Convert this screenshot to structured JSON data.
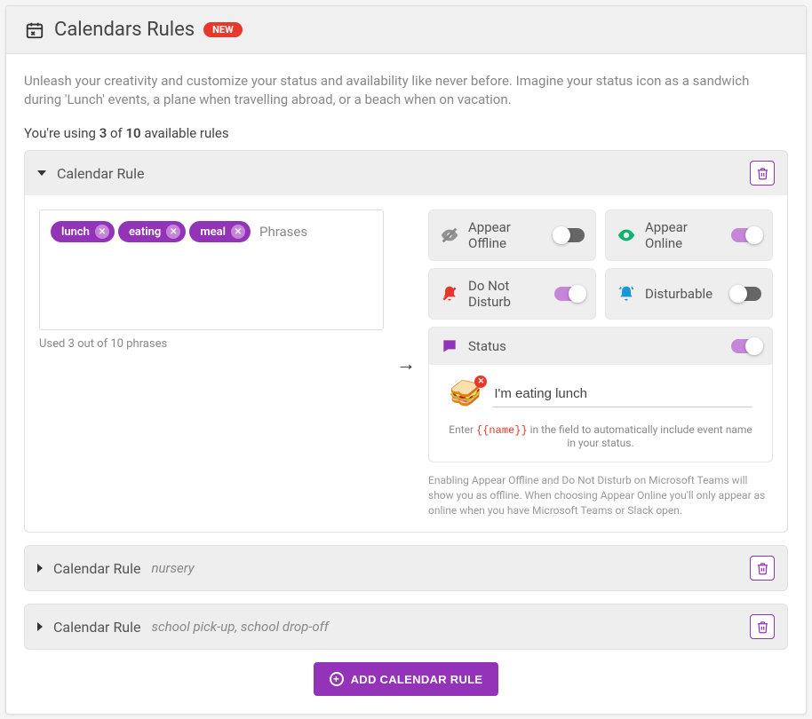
{
  "header": {
    "title": "Calendars Rules",
    "badge": "NEW"
  },
  "intro": "Unleash your creativity and customize your status and availability like never before. Imagine your status icon as a sandwich during 'Lunch' events, a plane when travelling abroad, or a beach when on vacation.",
  "usage": {
    "prefix": "You're using ",
    "used": "3",
    "of": " of ",
    "total": "10",
    "suffix": " available rules"
  },
  "rules": [
    {
      "title": "Calendar Rule",
      "expanded": true,
      "phrases": [
        "lunch",
        "eating",
        "meal"
      ],
      "phrases_placeholder": "Phrases",
      "phrases_usage": "Used 3 out of 10 phrases",
      "toggles": {
        "appear_offline": {
          "label": "Appear Offline",
          "on": false,
          "icon": "eye-off",
          "color": "#888"
        },
        "appear_online": {
          "label": "Appear Online",
          "on": true,
          "icon": "eye",
          "color": "#0bb36d"
        },
        "dnd": {
          "label": "Do Not Disturb",
          "on": true,
          "icon": "bell-off",
          "color": "#e6382c"
        },
        "disturbable": {
          "label": "Disturbable",
          "on": false,
          "icon": "bell",
          "color": "#1997d6"
        }
      },
      "status": {
        "label": "Status",
        "on": true,
        "emoji": "🥪",
        "value": "I'm eating lunch",
        "hint_prefix": "Enter ",
        "hint_code": "{{name}}",
        "hint_suffix": " in the field to automatically include event name in your status."
      },
      "footnote": "Enabling Appear Offline and Do Not Disturb on Microsoft Teams will show you as offline. When choosing Appear Online you'll only appear as online when you have Microsoft Teams or Slack open."
    },
    {
      "title": "Calendar Rule",
      "subtitle": "nursery",
      "expanded": false
    },
    {
      "title": "Calendar Rule",
      "subtitle": "school pick-up, school drop-off",
      "expanded": false
    }
  ],
  "add_button": "ADD CALENDAR RULE"
}
